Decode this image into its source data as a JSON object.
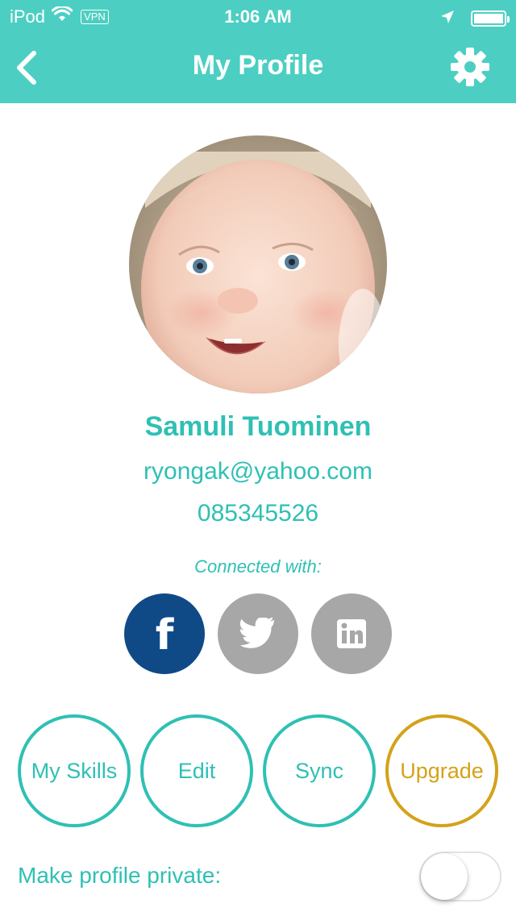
{
  "status_bar": {
    "carrier": "iPod",
    "vpn": "VPN",
    "time": "1:06 AM",
    "battery_level": 1.0
  },
  "nav": {
    "title": "My Profile",
    "back_icon": "chevron-left-icon",
    "settings_icon": "gear-icon"
  },
  "profile": {
    "name": "Samuli Tuominen",
    "email": "ryongak@yahoo.com",
    "phone": "085345526",
    "connected_label": "Connected with:"
  },
  "social": [
    {
      "icon": "facebook-icon",
      "connected": true,
      "color": "#0f4a86"
    },
    {
      "icon": "twitter-icon",
      "connected": false,
      "color": "#a7a7a7"
    },
    {
      "icon": "linkedin-icon",
      "connected": false,
      "color": "#a7a7a7"
    }
  ],
  "actions": {
    "skills": "My Skills",
    "edit": "Edit",
    "sync": "Sync",
    "upgrade": "Upgrade"
  },
  "privacy": {
    "label": "Make profile private:",
    "enabled": false
  },
  "colors": {
    "header": "#4ccfc2",
    "accent": "#2fc0b4",
    "upgrade": "#d4a21a",
    "facebook": "#0f4a86",
    "inactive_social": "#a7a7a7"
  }
}
